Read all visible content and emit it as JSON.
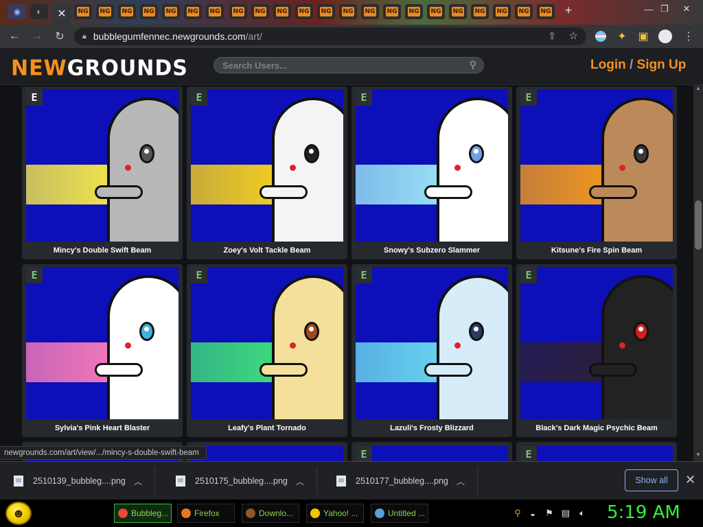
{
  "browser": {
    "active_tab_close": "✕",
    "url_domain": "bubblegumfennec.newgrounds.com",
    "url_path": "/art/",
    "tab_favicon_text": "NG",
    "new_tab": "+"
  },
  "site": {
    "logo_a": "NEW",
    "logo_b": "GROUNDS",
    "search_placeholder": "Search Users...",
    "login": "Login",
    "slash": "/",
    "signup": "Sign Up",
    "badge_letter": "E"
  },
  "art": [
    {
      "title": "Mincy's Double Swift Beam",
      "beam": "#f5ea4a",
      "body": "#b8b8b8",
      "eye": "#555555"
    },
    {
      "title": "Zoey's Volt Tackle Beam",
      "beam": "#f7d21c",
      "body": "#f4f4f4",
      "eye": "#222222"
    },
    {
      "title": "Snowy's Subzero Slammer",
      "beam": "#9be6f6",
      "body": "#ffffff",
      "eye": "#6fa0e0"
    },
    {
      "title": "Kitsune's Fire Spin Beam",
      "beam": "#f39a1a",
      "body": "#bc8a5a",
      "eye": "#3a3a3a"
    },
    {
      "title": "Sylvia's Pink Heart Blaster",
      "beam": "#f77ab9",
      "body": "#ffffff",
      "eye": "#3fb0e0"
    },
    {
      "title": "Leafy's Plant Tornado",
      "beam": "#3fe07a",
      "body": "#f4e09a",
      "eye": "#a0481a"
    },
    {
      "title": "Lazuli's Frosty Blizzard",
      "beam": "#6ad8ef",
      "body": "#d6ecf8",
      "eye": "#2a3a6a"
    },
    {
      "title": "Black's Dark Magic Psychic Beam",
      "beam": "#2b1f3a",
      "body": "#222222",
      "eye": "#d02020"
    }
  ],
  "status_url": "newgrounds.com/art/view/.../mincy-s-double-swift-beam",
  "downloads": {
    "items": [
      "2510139_bubbleg....png",
      "2510175_bubbleg....png",
      "2510177_bubbleg....png"
    ],
    "show_all": "Show all",
    "close": "✕"
  },
  "taskbar": {
    "tasks": [
      "Bubbleg...",
      "Firefox",
      "Downlo...",
      "Yahoo! ...",
      "Untitled ..."
    ],
    "clock": "5:19 AM"
  }
}
